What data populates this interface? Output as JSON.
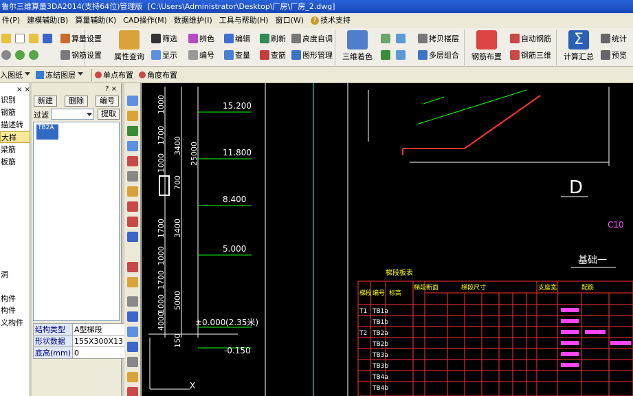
{
  "window": {
    "title_prefix": "鲁尔三维算量3DA2014(支持64位)管理版",
    "title_path": "[C:\\Users\\Administrator\\Desktop\\厂房\\厂房_2.dwg]"
  },
  "menu": [
    "件(P)",
    "建模辅助(B)",
    "算量辅助(K)",
    "CAD操作(M)",
    "数据维护(I)",
    "工具与帮助(H)",
    "窗口(W)",
    "技术支持"
  ],
  "ribbon": {
    "g1": [
      "算量设置",
      "钢筋设置"
    ],
    "attr_query": "属性查询",
    "g2": [
      "筛选",
      "辨色",
      "编辑",
      "刷新",
      "高度自调",
      "显示",
      "编号",
      "查量",
      "查筋",
      "图形管理"
    ],
    "shading": "三维着色",
    "g3": [
      "拷贝楼层",
      "多层组合"
    ],
    "rebar_layout": "钢筋布置",
    "g4": [
      "自动钢筋",
      "钢筋三维"
    ],
    "calc_summary": "计算汇总",
    "g5": [
      "统计",
      "预览"
    ]
  },
  "subbar": [
    "入图纸",
    "冻结图层",
    "单点布置",
    "角度布置"
  ],
  "leftnav": [
    "识别",
    "钢筋",
    "描述转",
    "大样",
    "梁筋",
    "板筋",
    "洞",
    "构件",
    "构件",
    "义构件"
  ],
  "leftnav_selected_index": 3,
  "panel": {
    "btn_new": "新建",
    "btn_delete": "删除",
    "btn_number": "编号",
    "filter_label": "过滤",
    "btn_extract": "提取",
    "list_item": "TB2A",
    "props": [
      {
        "k": "结构类型",
        "v": "A型梯段"
      },
      {
        "k": "形状数据",
        "v": "155X300X13"
      },
      {
        "k": "底高(mm)",
        "v": "0"
      }
    ]
  },
  "drawing": {
    "elev_labels": [
      "15.200",
      "11.800",
      "8.400",
      "5.000",
      "±0.000",
      "(2.35米)",
      "-0.150"
    ],
    "dims_vert_a": [
      "1000",
      "1700",
      "1000",
      "1700",
      "1000",
      "1700",
      "1000",
      "4000"
    ],
    "dims_vert_b": [
      "3400",
      "700",
      "3400",
      "700",
      "3400",
      "700",
      "5000"
    ],
    "dim_total": "25000",
    "dim_small": "150",
    "axis_x": "X",
    "marker_D": "D",
    "label_C10": "C10",
    "foundation": "基础一",
    "table_title": "梯段板表",
    "table_headers": [
      "梯段",
      "编号",
      "标高",
      "梯段断面",
      "梯段尺寸",
      "支座宽",
      "配筋"
    ],
    "table_rows": [
      [
        "T1",
        "TB1a"
      ],
      [
        "",
        "TB1b"
      ],
      [
        "T2",
        "TB2a"
      ],
      [
        "",
        "TB2b"
      ],
      [
        "",
        "TB3a"
      ],
      [
        "",
        "TB3b"
      ],
      [
        "",
        "TB4a"
      ],
      [
        "",
        "TB4b"
      ]
    ]
  }
}
